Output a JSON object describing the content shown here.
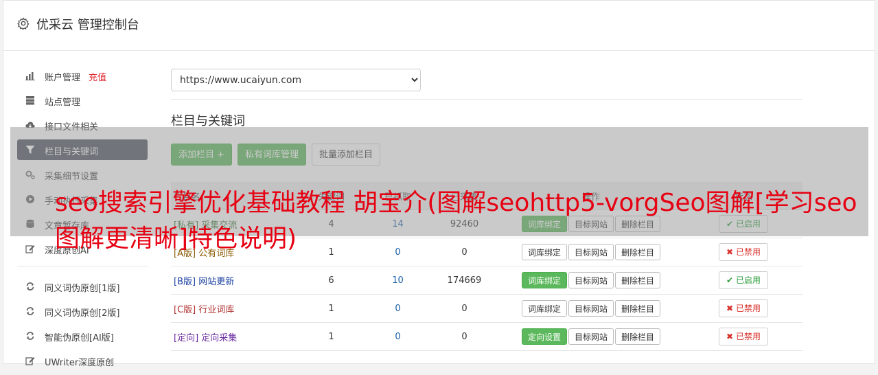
{
  "header": {
    "title": "优采云 管理控制台",
    "icon": "gear-icon"
  },
  "sidebar": {
    "items": [
      {
        "label": "账户管理",
        "extra": "充值",
        "icon": "bar-chart-icon",
        "active": false
      },
      {
        "label": "站点管理",
        "icon": "server-icon",
        "active": false
      },
      {
        "label": "接口文件相关",
        "icon": "cloud-download-icon",
        "active": false
      },
      {
        "label": "栏目与关键词",
        "icon": "filter-icon",
        "active": true
      },
      {
        "label": "采集细节设置",
        "icon": "gears-icon",
        "active": false
      },
      {
        "label": "手动执行采集",
        "icon": "play-circle-icon",
        "active": false
      },
      {
        "label": "文章暂存库",
        "icon": "database-icon",
        "active": false
      },
      {
        "label": "深度原创AI",
        "icon": "edit-icon",
        "active": false
      }
    ],
    "items2": [
      {
        "label": "同义词伪原创[1版]",
        "icon": "refresh-icon"
      },
      {
        "label": "同义词伪原创[2版]",
        "icon": "refresh-icon"
      },
      {
        "label": "智能伪原创[AI版]",
        "icon": "refresh-icon"
      },
      {
        "label": "UWriter深度原创",
        "icon": "edit-icon"
      }
    ]
  },
  "main": {
    "site_select": "https://www.ucaiyun.com",
    "section_title": "栏目与关键词",
    "buttons": {
      "add_column": "添加栏目 +",
      "private_lib": "私有词库管理",
      "batch_add": "批量添加栏目"
    },
    "table": {
      "headers": [
        "栏目名",
        "关键词",
        "已抓取",
        "已采集",
        "操作",
        "状态"
      ],
      "rows": [
        {
          "tag": "[私有]",
          "name": "采集交流",
          "kw": "4",
          "fetched": "14",
          "collected": "92460",
          "op1": "词库绑定",
          "op1_active": true,
          "op2": "目标网站",
          "op3": "删除栏目",
          "status": "已启用",
          "enabled": true,
          "tagclass": "tag-private"
        },
        {
          "tag": "[A版]",
          "name": "公有词库",
          "kw": "1",
          "fetched": "0",
          "collected": "0",
          "op1": "词库绑定",
          "op1_active": false,
          "op2": "目标网站",
          "op3": "删除栏目",
          "status": "已禁用",
          "enabled": false,
          "tagclass": "tag-a"
        },
        {
          "tag": "[B版]",
          "name": "网站更新",
          "kw": "6",
          "fetched": "10",
          "collected": "174669",
          "op1": "词库绑定",
          "op1_active": true,
          "op2": "目标网站",
          "op3": "删除栏目",
          "status": "已启用",
          "enabled": true,
          "tagclass": "tag-b"
        },
        {
          "tag": "[C版]",
          "name": "行业词库",
          "kw": "1",
          "fetched": "0",
          "collected": "0",
          "op1": "词库绑定",
          "op1_active": false,
          "op2": "目标网站",
          "op3": "删除栏目",
          "status": "已禁用",
          "enabled": false,
          "tagclass": "tag-c"
        },
        {
          "tag": "[定向]",
          "name": "定向采集",
          "kw": "1",
          "fetched": "0",
          "collected": "0",
          "op1": "定向设置",
          "op1_active": true,
          "op2": "目标网站",
          "op3": "删除栏目",
          "status": "已禁用",
          "enabled": false,
          "tagclass": "tag-d"
        }
      ]
    }
  },
  "overlay": {
    "text": "seo搜索引擎优化基础教程 胡宝介(图解seohttp5-vorgSeo图解[学习seo图解更清晰]特色说明)"
  },
  "colors": {
    "accent_green": "#5cb85c",
    "active_nav": "#4d5560",
    "red": "#e60012",
    "blue": "#1a5fa8"
  }
}
